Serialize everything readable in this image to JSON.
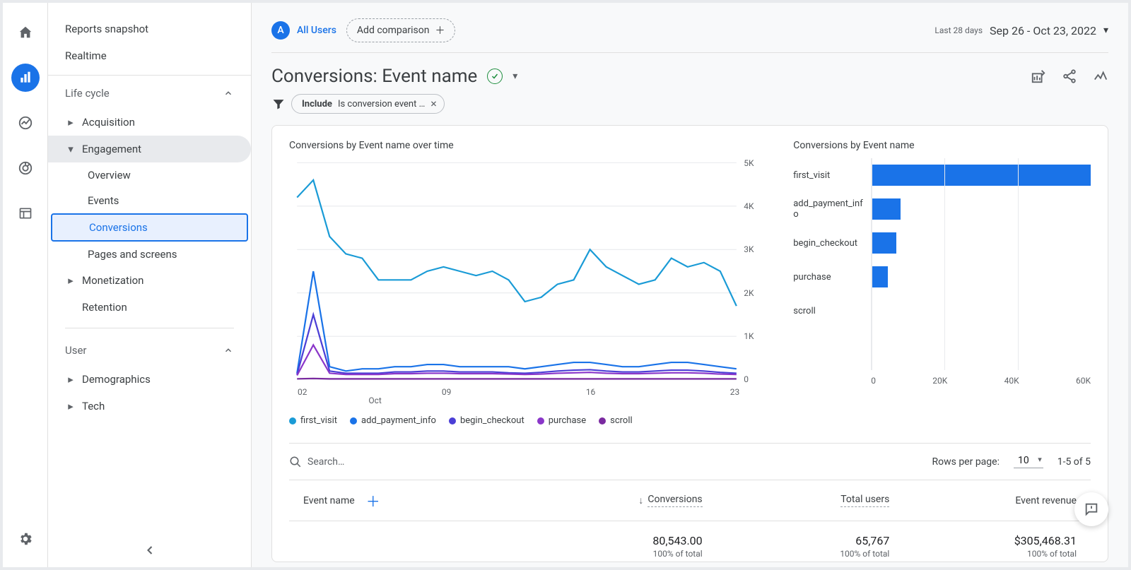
{
  "rail": {
    "items": [
      "home",
      "reports",
      "explore",
      "advertising",
      "configure"
    ]
  },
  "sidebar": {
    "snapshot": "Reports snapshot",
    "realtime": "Realtime",
    "lifecycle_header": "Life cycle",
    "acquisition": "Acquisition",
    "engagement": "Engagement",
    "overview": "Overview",
    "events": "Events",
    "conversions": "Conversions",
    "pages": "Pages and screens",
    "monetization": "Monetization",
    "retention": "Retention",
    "user_header": "User",
    "demographics": "Demographics",
    "tech": "Tech"
  },
  "topbar": {
    "segment_letter": "A",
    "segment_label": "All Users",
    "add_comparison": "Add comparison",
    "date_label": "Last 28 days",
    "date_range": "Sep 26 - Oct 23, 2022"
  },
  "title": {
    "text": "Conversions: Event name"
  },
  "filter": {
    "prefix": "Include",
    "text": "Is conversion event …"
  },
  "chart_data": [
    {
      "type": "line",
      "title": "Conversions by Event name over time",
      "ylabel": "",
      "ylim": [
        0,
        5000
      ],
      "yticks": [
        "5K",
        "4K",
        "3K",
        "2K",
        "1K",
        "0"
      ],
      "xticks": [
        "02",
        "09",
        "16",
        "23"
      ],
      "xsub": "Oct",
      "series": [
        {
          "name": "first_visit",
          "color": "#1a9bd6",
          "values": [
            4200,
            4600,
            3300,
            2900,
            2800,
            2300,
            2300,
            2300,
            2500,
            2600,
            2500,
            2400,
            2500,
            2300,
            1800,
            1900,
            2200,
            2300,
            3000,
            2600,
            2400,
            2200,
            2300,
            2800,
            2600,
            2700,
            2500,
            1700
          ]
        },
        {
          "name": "add_payment_info",
          "color": "#1a73e8",
          "values": [
            150,
            2500,
            300,
            200,
            250,
            250,
            300,
            300,
            350,
            350,
            300,
            300,
            300,
            300,
            250,
            300,
            350,
            400,
            400,
            350,
            300,
            300,
            350,
            400,
            400,
            350,
            300,
            250
          ]
        },
        {
          "name": "begin_checkout",
          "color": "#4b3fd6",
          "values": [
            120,
            1500,
            200,
            150,
            150,
            150,
            180,
            180,
            200,
            200,
            180,
            180,
            180,
            160,
            150,
            170,
            200,
            220,
            230,
            200,
            180,
            180,
            200,
            220,
            220,
            200,
            170,
            150
          ]
        },
        {
          "name": "purchase",
          "color": "#8a36c9",
          "values": [
            100,
            800,
            150,
            120,
            120,
            120,
            140,
            140,
            150,
            150,
            140,
            140,
            140,
            130,
            120,
            130,
            150,
            160,
            170,
            150,
            140,
            140,
            150,
            160,
            160,
            150,
            130,
            120
          ]
        },
        {
          "name": "scroll",
          "color": "#7a2aa0",
          "values": [
            20,
            30,
            20,
            20,
            20,
            20,
            20,
            20,
            20,
            20,
            20,
            20,
            20,
            20,
            20,
            20,
            20,
            20,
            20,
            20,
            20,
            20,
            20,
            20,
            20,
            20,
            20,
            20
          ]
        }
      ]
    },
    {
      "type": "bar",
      "title": "Conversions by Event name",
      "orientation": "horizontal",
      "categories": [
        "first_visit",
        "add_payment_info",
        "begin_checkout",
        "purchase",
        "scroll"
      ],
      "values": [
        63000,
        8000,
        7000,
        4500,
        80
      ],
      "xlim": [
        0,
        60000
      ],
      "xticks": [
        "0",
        "20K",
        "40K",
        "60K"
      ],
      "color": "#1a73e8"
    }
  ],
  "legend": [
    {
      "name": "first_visit",
      "color": "#1a9bd6"
    },
    {
      "name": "add_payment_info",
      "color": "#1a73e8"
    },
    {
      "name": "begin_checkout",
      "color": "#4b3fd6"
    },
    {
      "name": "purchase",
      "color": "#8a36c9"
    },
    {
      "name": "scroll",
      "color": "#7a2aa0"
    }
  ],
  "table": {
    "search_placeholder": "Search…",
    "rows_per_page_label": "Rows per page:",
    "rows_per_page_value": "10",
    "range": "1-5 of 5",
    "columns": {
      "event_name": "Event name",
      "conversions": "Conversions",
      "total_users": "Total users",
      "event_revenue": "Event revenue"
    },
    "totals": {
      "conversions": "80,543.00",
      "conversions_pct": "100% of total",
      "total_users": "65,767",
      "total_users_pct": "100% of total",
      "event_revenue": "$305,468.31",
      "event_revenue_pct": "100% of total"
    }
  }
}
